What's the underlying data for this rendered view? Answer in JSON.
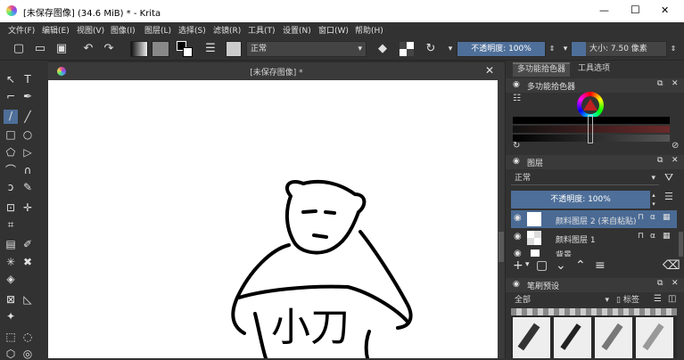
{
  "window": {
    "title": "[未保存图像] (34.6 MiB) * - Krita",
    "min_glyph": "—",
    "max_glyph": "☐",
    "close_glyph": "✕"
  },
  "menu": [
    "文件(F)",
    "编辑(E)",
    "视图(V)",
    "图像(I)",
    "图层(L)",
    "选择(S)",
    "滤镜(R)",
    "工具(T)",
    "设置(N)",
    "窗口(W)",
    "帮助(H)"
  ],
  "toolbar": {
    "blend_mode": "正常",
    "opacity_label": "不透明度: 100%",
    "size_label": "大小: 7.50 像素"
  },
  "document": {
    "tab_title": "[未保存图像] *",
    "canvas_text": "小刀"
  },
  "dockers": {
    "tabs": [
      "多功能拾色器",
      "工具选项"
    ],
    "color_selector_title": "多功能拾色器",
    "layers_title": "图层",
    "layers_blend": "正常",
    "layers_opacity": "不透明度: 100%",
    "layers": [
      {
        "name": "颜料图层 2 (来自粘贴)",
        "selected": true
      },
      {
        "name": "颜料图层 1",
        "selected": false
      },
      {
        "name": "背景",
        "selected": false
      }
    ],
    "brush_title": "笔刷预设",
    "brush_filter": "全部",
    "brush_tag": "标签"
  },
  "colors": {
    "accent": "#4e6f99",
    "selected_layer": "#4a6a94"
  }
}
